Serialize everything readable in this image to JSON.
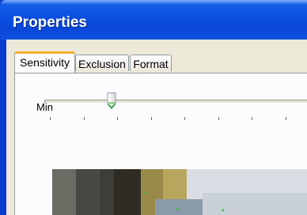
{
  "window": {
    "title": "Properties",
    "title_bar_color": "#0a48d8",
    "client_color": "#ece9d8"
  },
  "tabs": [
    {
      "label": "Sensitivity",
      "active": true
    },
    {
      "label": "Exclusion",
      "active": false
    },
    {
      "label": "Format",
      "active": false
    }
  ],
  "sensitivity": {
    "slider_level": 0.25,
    "min_label": "Min",
    "tick_count": 9
  },
  "preview": {
    "description_icon": "camera-preview-image"
  }
}
